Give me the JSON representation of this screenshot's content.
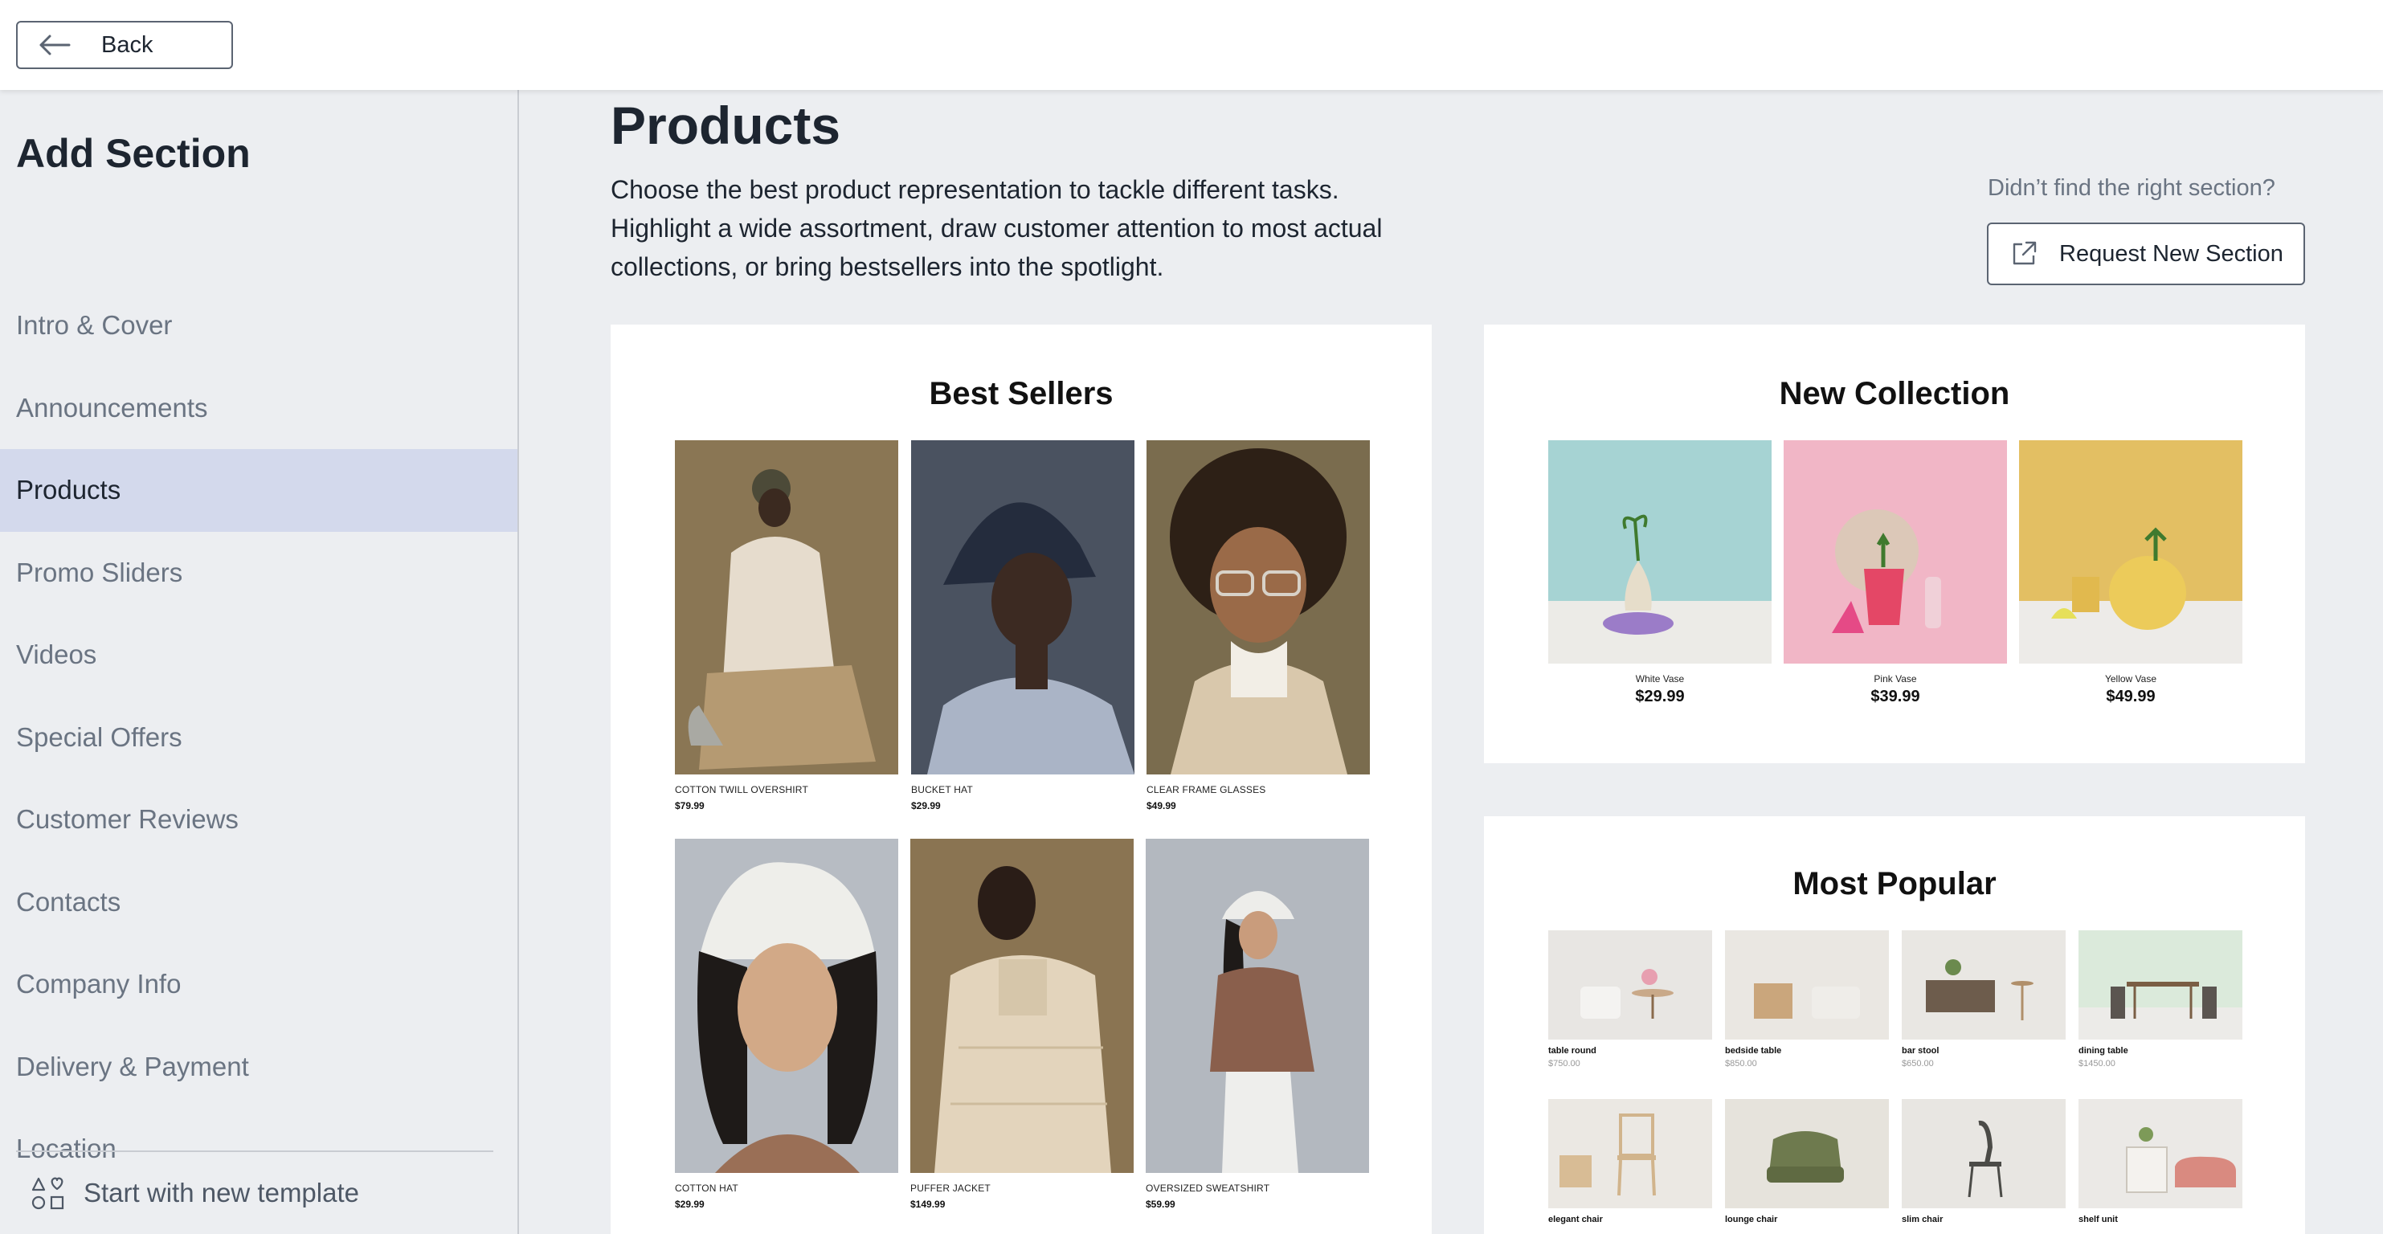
{
  "topbar": {
    "back_label": "Back"
  },
  "sidebar": {
    "title": "Add Section",
    "items": [
      {
        "label": "Intro & Cover",
        "active": false
      },
      {
        "label": "Announcements",
        "active": false
      },
      {
        "label": "Products",
        "active": true
      },
      {
        "label": "Promo Sliders",
        "active": false
      },
      {
        "label": "Videos",
        "active": false
      },
      {
        "label": "Special Offers",
        "active": false
      },
      {
        "label": "Customer Reviews",
        "active": false
      },
      {
        "label": "Contacts",
        "active": false
      },
      {
        "label": "Company Info",
        "active": false
      },
      {
        "label": "Delivery & Payment",
        "active": false
      },
      {
        "label": "Location",
        "active": false
      }
    ],
    "new_template_label": "Start with new template"
  },
  "main": {
    "title": "Products",
    "description_lines": [
      "Choose the best product representation to tackle different tasks.",
      "Highlight a wide assortment, draw customer attention to most actual",
      "collections, or bring bestsellers into the spotlight."
    ],
    "hint": "Didn’t find the right section?",
    "request_label": "Request New Section"
  },
  "cards": {
    "best_sellers": {
      "title": "Best Sellers",
      "items": [
        {
          "name": "COTTON TWILL OVERSHIRT",
          "price": "$79.99"
        },
        {
          "name": "BUCKET HAT",
          "price": "$29.99"
        },
        {
          "name": "CLEAR FRAME GLASSES",
          "price": "$49.99"
        },
        {
          "name": "COTTON HAT",
          "price": "$29.99"
        },
        {
          "name": "PUFFER JACKET",
          "price": "$149.99"
        },
        {
          "name": "OVERSIZED SWEATSHIRT",
          "price": "$59.99"
        }
      ]
    },
    "new_collection": {
      "title": "New Collection",
      "items": [
        {
          "name": "White Vase",
          "price": "$29.99"
        },
        {
          "name": "Pink Vase",
          "price": "$39.99"
        },
        {
          "name": "Yellow Vase",
          "price": "$49.99"
        }
      ]
    },
    "most_popular": {
      "title": "Most Popular",
      "items": [
        {
          "name": "table round",
          "price": "$750.00"
        },
        {
          "name": "bedside table",
          "price": "$850.00"
        },
        {
          "name": "bar stool",
          "price": "$650.00"
        },
        {
          "name": "dining table",
          "price": "$1450.00"
        },
        {
          "name": "elegant chair",
          "price": ""
        },
        {
          "name": "lounge chair",
          "price": ""
        },
        {
          "name": "slim chair",
          "price": ""
        },
        {
          "name": "shelf unit",
          "price": ""
        }
      ]
    }
  },
  "colors": {
    "accent_active": "#d3d9ec",
    "background": "#eceef1",
    "text_primary": "#1d2530",
    "text_muted": "#6a7482"
  },
  "icons": {
    "back": "arrow-left-icon",
    "request": "external-link-icon",
    "template": "shapes-icon"
  }
}
